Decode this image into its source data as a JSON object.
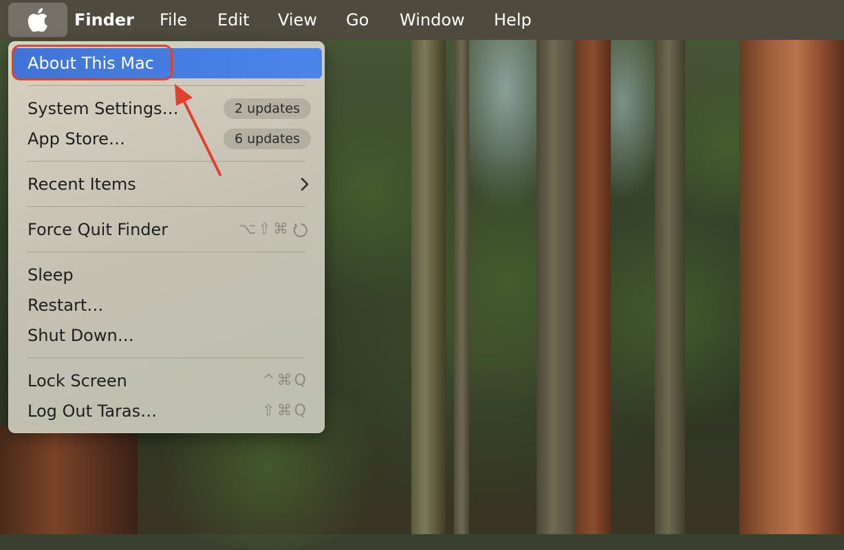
{
  "menubar": {
    "app_name": "Finder",
    "menus": [
      "File",
      "Edit",
      "View",
      "Go",
      "Window",
      "Help"
    ]
  },
  "apple_menu": {
    "about": "About This Mac",
    "system_settings": {
      "label": "System Settings…",
      "badge": "2 updates"
    },
    "app_store": {
      "label": "App Store…",
      "badge": "6 updates"
    },
    "recent_items": "Recent Items",
    "force_quit": {
      "label": "Force Quit Finder",
      "shortcut": "⌥⇧⌘"
    },
    "sleep": "Sleep",
    "restart": "Restart…",
    "shut_down": "Shut Down…",
    "lock_screen": {
      "label": "Lock Screen",
      "shortcut": "^⌘Q"
    },
    "log_out": {
      "label": "Log Out Taras…",
      "shortcut": "⇧⌘Q"
    }
  },
  "colors": {
    "highlight": "#4a86e8",
    "annotation": "#e0402e"
  }
}
